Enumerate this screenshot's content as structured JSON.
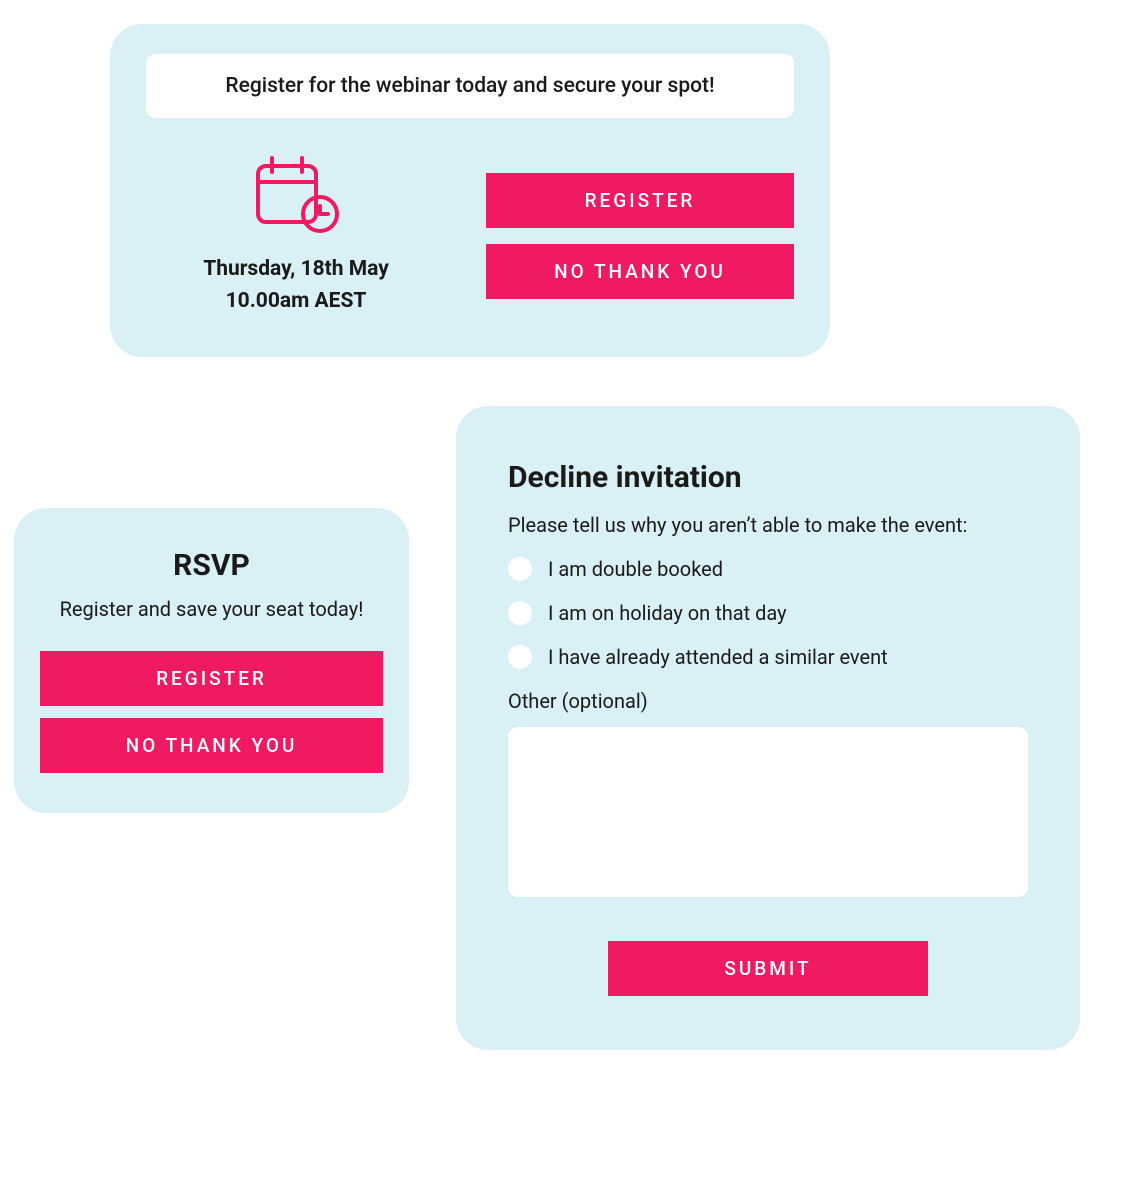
{
  "colors": {
    "card_bg": "#d9f0f5",
    "accent": "#ef1a62",
    "text": "#1a1a1a"
  },
  "webinar_card": {
    "banner": "Register for the webinar today and secure your spot!",
    "date_line1": "Thursday, 18th May",
    "date_line2": "10.00am AEST",
    "register_label": "REGISTER",
    "decline_label": "NO THANK YOU",
    "icon": "calendar-clock-icon"
  },
  "rsvp_card": {
    "title": "RSVP",
    "subtitle": "Register and save your seat today!",
    "register_label": "REGISTER",
    "decline_label": "NO THANK YOU"
  },
  "decline_card": {
    "title": "Decline invitation",
    "subtitle": "Please tell us why you aren’t able to make the event:",
    "options": [
      "I am double booked",
      "I am on holiday on that day",
      "I have already attended a similar event"
    ],
    "other_label": "Other (optional)",
    "other_value": "",
    "submit_label": "SUBMIT"
  }
}
